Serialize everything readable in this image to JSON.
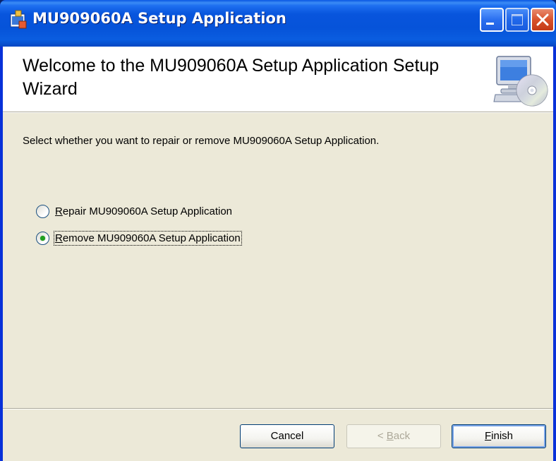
{
  "window": {
    "title": "MU909060A Setup Application",
    "title_icon": "setup-installer-icon"
  },
  "caption_buttons": {
    "minimize_icon": "minimize-icon",
    "maximize_icon": "maximize-icon",
    "close_icon": "close-icon"
  },
  "banner": {
    "title": "Welcome to the MU909060A Setup Application Setup Wizard",
    "icon": "computer-cd-icon"
  },
  "instruction": "Select whether you want to repair or remove MU909060A Setup Application.",
  "options": [
    {
      "mnemonic": "R",
      "rest": "epair MU909060A Setup Application",
      "selected": false
    },
    {
      "mnemonic": "R",
      "rest": "emove MU909060A Setup Application",
      "selected": true
    }
  ],
  "buttons": {
    "cancel": "Cancel",
    "back_prefix": "< ",
    "back_mnemonic": "B",
    "back_rest": "ack",
    "finish_mnemonic": "F",
    "finish_rest": "inish"
  },
  "colors": {
    "titlebar": "#0a57e3",
    "dialog_background": "#ece9d8",
    "radio_dot": "#21a121",
    "close_button": "#d8522b"
  }
}
